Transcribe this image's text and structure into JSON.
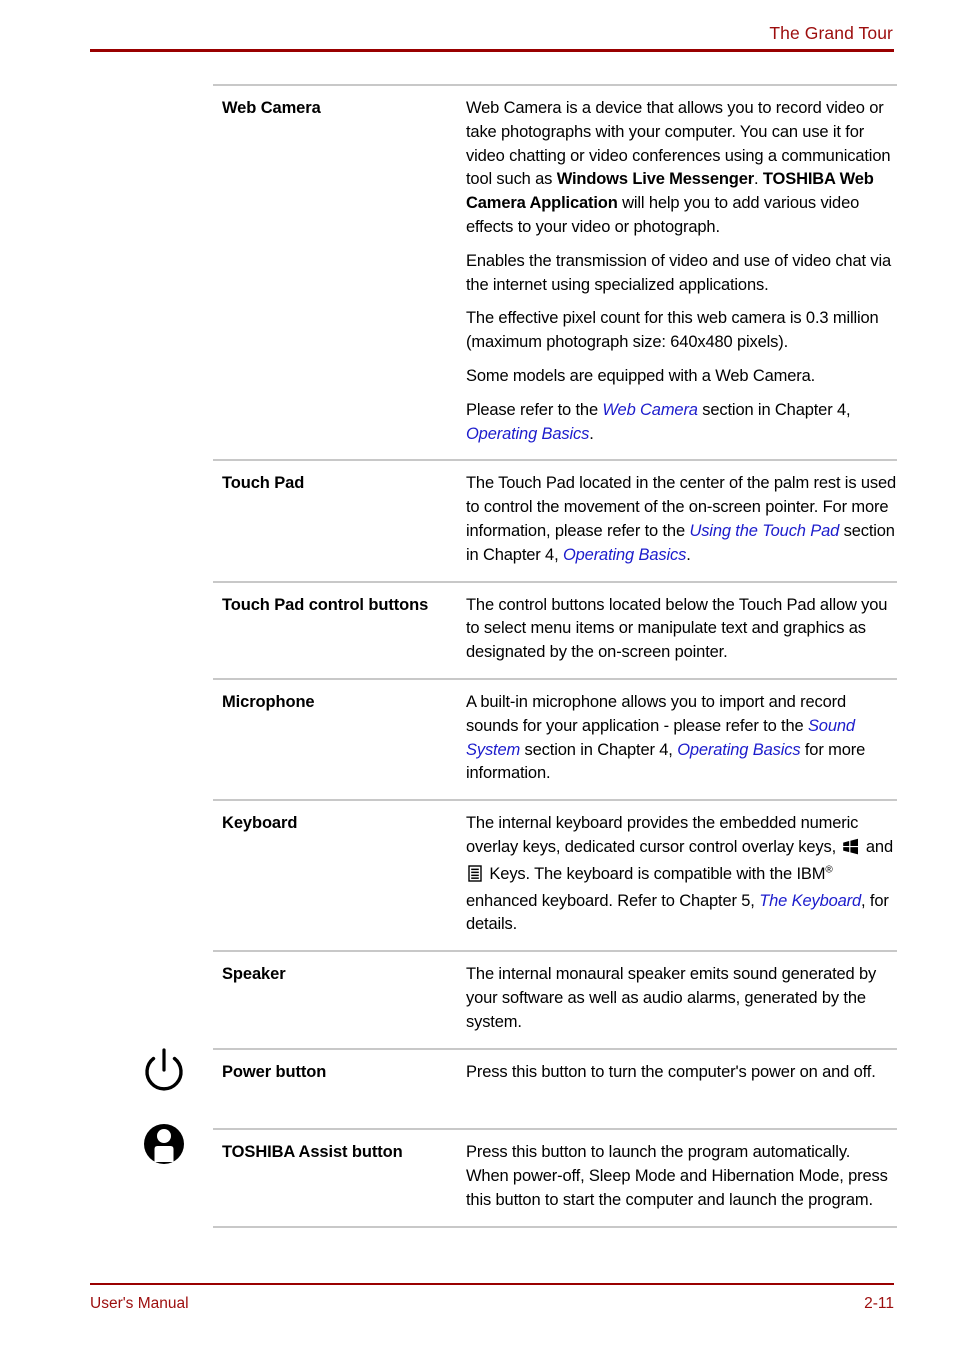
{
  "header": {
    "title": "The Grand Tour"
  },
  "footer": {
    "left_label": "User's Manual",
    "page_number": "2-11"
  },
  "colors": {
    "header_red": "#990000",
    "footer_red": "#9c0d0d",
    "link_blue": "#1c1ccc",
    "rule_gray": "#c8c8c8"
  },
  "margin_icons": [
    {
      "name": "power-symbol-icon",
      "for_row": "Power button"
    },
    {
      "name": "toshiba-assist-person-icon",
      "for_row": "TOSHIBA Assist button"
    }
  ],
  "table": {
    "rows": [
      {
        "term": "Web Camera",
        "paragraphs": [
          {
            "parts": [
              {
                "text": "Web Camera is a device that allows you to record video or take photographs with your computer. You can use it for video chatting or video conferences using a communication tool such as ",
                "style": "plain"
              },
              {
                "text": "Windows Live Messenger",
                "style": "bold"
              },
              {
                "text": ". ",
                "style": "plain"
              },
              {
                "text": "TOSHIBA Web Camera Application",
                "style": "bold"
              },
              {
                "text": " will help you to add various video effects to your video or photograph.",
                "style": "plain"
              }
            ]
          },
          {
            "parts": [
              {
                "text": "Enables the transmission of video and use of video chat via the internet using specialized applications.",
                "style": "plain"
              }
            ]
          },
          {
            "parts": [
              {
                "text": "The effective pixel count for this web camera is 0.3 million (maximum photograph size: 640x480 pixels).",
                "style": "plain"
              }
            ]
          },
          {
            "parts": [
              {
                "text": "Some models are equipped with a Web Camera.",
                "style": "plain"
              }
            ]
          },
          {
            "parts": [
              {
                "text": "Please refer to the ",
                "style": "plain"
              },
              {
                "text": "Web Camera",
                "style": "link"
              },
              {
                "text": " section in Chapter 4, ",
                "style": "plain"
              },
              {
                "text": "Operating Basics",
                "style": "link"
              },
              {
                "text": ".",
                "style": "plain"
              }
            ]
          }
        ]
      },
      {
        "term": "Touch Pad",
        "paragraphs": [
          {
            "parts": [
              {
                "text": "The Touch Pad located in the center of the palm rest is used to control the movement of the on-screen pointer. For more information, please refer to the ",
                "style": "plain"
              },
              {
                "text": "Using the Touch Pad",
                "style": "link"
              },
              {
                "text": " section in Chapter 4, ",
                "style": "plain"
              },
              {
                "text": "Operating Basics",
                "style": "link"
              },
              {
                "text": ".",
                "style": "plain"
              }
            ]
          }
        ]
      },
      {
        "term": "Touch Pad control buttons",
        "paragraphs": [
          {
            "parts": [
              {
                "text": "The control buttons located below the Touch Pad allow you to select menu items or manipulate text and graphics as designated by the on-screen pointer.",
                "style": "plain"
              }
            ]
          }
        ]
      },
      {
        "term": "Microphone",
        "paragraphs": [
          {
            "parts": [
              {
                "text": "A built-in microphone allows you to import and record sounds for your application - please refer to the ",
                "style": "plain"
              },
              {
                "text": "Sound System",
                "style": "link"
              },
              {
                "text": " section in Chapter 4, ",
                "style": "plain"
              },
              {
                "text": "Operating Basics",
                "style": "link"
              },
              {
                "text": " for more information.",
                "style": "plain"
              }
            ]
          }
        ]
      },
      {
        "term": "Keyboard",
        "paragraphs": [
          {
            "parts": [
              {
                "text": "The internal keyboard provides the embedded numeric overlay keys, dedicated cursor control overlay keys, ",
                "style": "plain"
              },
              {
                "text": "",
                "style": "icon-windows-key"
              },
              {
                "text": " and ",
                "style": "plain"
              },
              {
                "text": "",
                "style": "icon-application-key"
              },
              {
                "text": " Keys. The keyboard is compatible with the IBM",
                "style": "plain"
              },
              {
                "text": "®",
                "style": "sup"
              },
              {
                "text": " enhanced keyboard. Refer to Chapter 5, ",
                "style": "plain"
              },
              {
                "text": "The Keyboard",
                "style": "link"
              },
              {
                "text": ", for details.",
                "style": "plain"
              }
            ]
          }
        ]
      },
      {
        "term": "Speaker",
        "paragraphs": [
          {
            "parts": [
              {
                "text": "The internal monaural speaker emits sound generated by your software as well as audio alarms, generated by the system.",
                "style": "plain"
              }
            ]
          }
        ]
      },
      {
        "term": "Power button",
        "tall": true,
        "paragraphs": [
          {
            "parts": [
              {
                "text": "Press this button to turn the computer's power on and off.",
                "style": "plain"
              }
            ]
          }
        ]
      },
      {
        "term": "TOSHIBA Assist button",
        "paragraphs": [
          {
            "parts": [
              {
                "text": "Press this button to launch the program automatically. When power-off, Sleep Mode and Hibernation Mode, press this button to start the computer and launch the program.",
                "style": "plain"
              }
            ]
          }
        ]
      }
    ]
  }
}
